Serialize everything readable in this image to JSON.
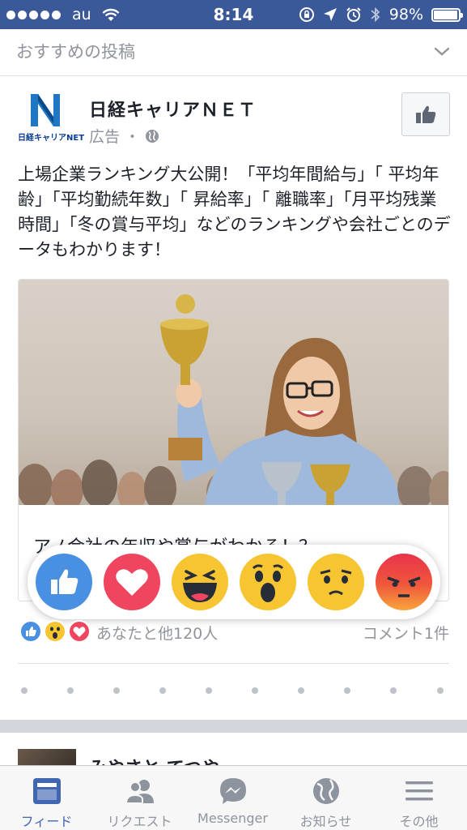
{
  "status_bar": {
    "carrier": "au",
    "time": "8:14",
    "battery": "98%",
    "battery_level": 0.98
  },
  "section": {
    "title": "おすすめの投稿"
  },
  "post": {
    "page_name": "日経キャリアＮＥＴ",
    "logo_text": "日経キャリアNET",
    "sponsored": "広告",
    "separator": "・",
    "text": "上場企業ランキング大公開！「平均年間給与」「 平均年齢」「平均勤続年数」「 昇給率」「 離職率」「月平均残業時間」「冬の賞与平均」などのランキングや会社ごとのデータもわかります！",
    "attachment_title": "アノ会社の年収や賞与がわかる！？",
    "reaction_summary": "あなたと他120人",
    "comments": "コメント1件"
  },
  "reactions": [
    {
      "name": "like",
      "color": "#4a90e2"
    },
    {
      "name": "love",
      "color": "#f0455f"
    },
    {
      "name": "haha",
      "color": "#f7c531"
    },
    {
      "name": "wow",
      "color": "#f7c531"
    },
    {
      "name": "sad",
      "color": "#f7c531"
    },
    {
      "name": "angry",
      "color": "#f0573c"
    }
  ],
  "next_post": {
    "name": "みやさと てつや"
  },
  "tab_bar": {
    "tabs": [
      {
        "label": "フィード",
        "icon": "feed-icon",
        "active": true
      },
      {
        "label": "リクエスト",
        "icon": "friend-requests-icon",
        "active": false
      },
      {
        "label": "Messenger",
        "icon": "messenger-icon",
        "active": false
      },
      {
        "label": "お知らせ",
        "icon": "globe-icon",
        "active": false
      },
      {
        "label": "その他",
        "icon": "menu-icon",
        "active": false
      }
    ]
  },
  "colors": {
    "brand": "#3b5998",
    "active_tab": "#4267b2",
    "secondary_text": "#90949c"
  }
}
